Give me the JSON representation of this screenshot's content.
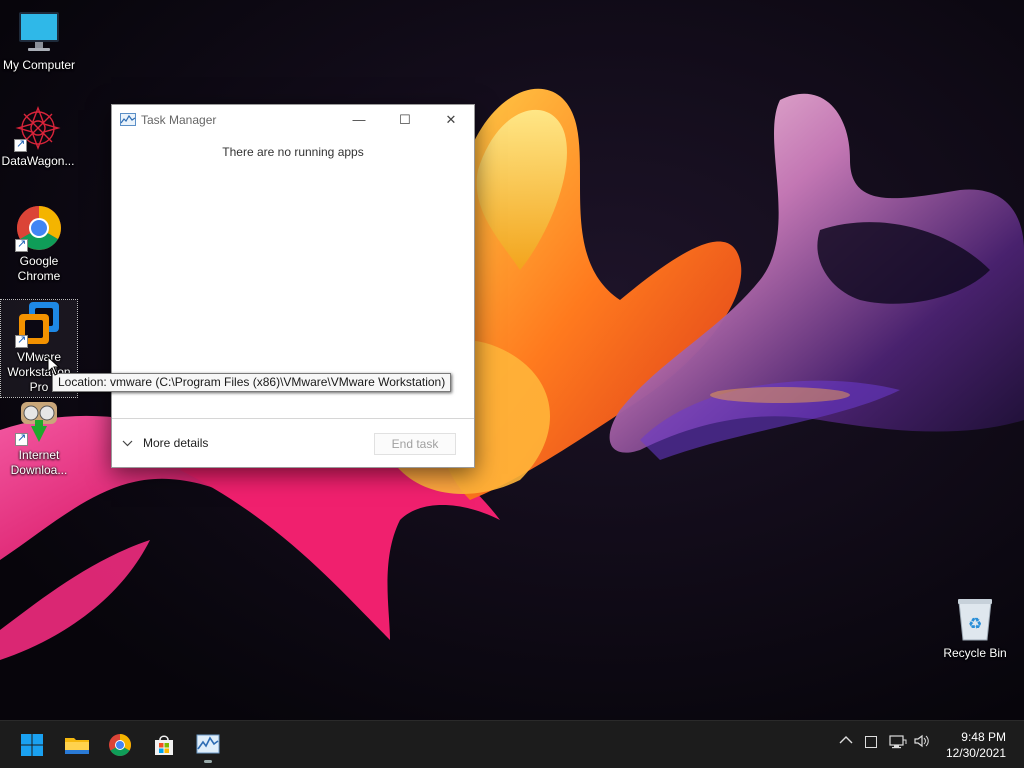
{
  "desktop": {
    "icons": [
      {
        "label": "My Computer"
      },
      {
        "label": "DataWagon..."
      },
      {
        "label": "Google Chrome"
      },
      {
        "label": "VMware Workstation Pro"
      },
      {
        "label": "Internet Downloa..."
      },
      {
        "label": "Recycle Bin"
      }
    ],
    "selected_icon": "VMware Workstation Pro"
  },
  "tooltip": {
    "text": "Location: vmware (C:\\Program Files (x86)\\VMware\\VMware Workstation)"
  },
  "task_manager": {
    "title": "Task Manager",
    "empty_message": "There are no running apps",
    "more_details_label": "More details",
    "end_task_label": "End task",
    "controls": {
      "minimize": "—",
      "maximize": "☐",
      "close": "✕"
    }
  },
  "taskbar": {
    "pinned": [
      {
        "icon": "start-windows-icon"
      },
      {
        "icon": "file-explorer-icon"
      },
      {
        "icon": "chrome-icon"
      },
      {
        "icon": "microsoft-store-icon"
      },
      {
        "icon": "task-manager-icon",
        "active": true
      }
    ],
    "tray": {
      "chevron": "^",
      "volume_icon": "🔊"
    },
    "clock": {
      "time": "9:48 PM",
      "date": "12/30/2021"
    }
  },
  "colors": {
    "taskbar_bg": "#1c1c1c",
    "windows_blue": "#1aa1f1",
    "wallpaper_bg": "#0b0813"
  }
}
